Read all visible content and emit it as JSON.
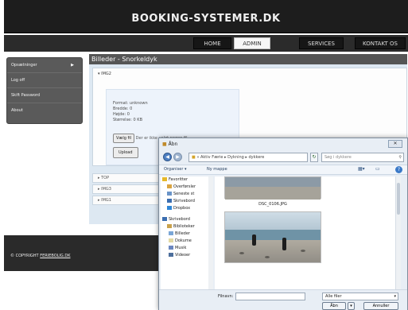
{
  "site": {
    "title": "BOOKING-SYSTEMER.DK"
  },
  "nav": {
    "items": [
      {
        "label": "HOME"
      },
      {
        "label": "ADMIN"
      },
      {
        "label": "SERVICES"
      },
      {
        "label": "KONTAKT OS"
      }
    ]
  },
  "sidebar": {
    "items": [
      {
        "label": "Opsætninger"
      },
      {
        "label": "Log off"
      },
      {
        "label": "Skift Password"
      },
      {
        "label": "About"
      }
    ]
  },
  "content": {
    "title": "Billeder - Snorkeldyk",
    "panel_header": "IMG2",
    "format": "Format: unknown",
    "width": "Bredde: 0",
    "height": "Højde: 0",
    "size": "Størrelse: 0 KB",
    "choose_label": "Vælg fil",
    "choose_status": "Der er ikke valgt nogen fil",
    "upload_label": "Upload",
    "collapsed": [
      "TOP",
      "IMG3",
      "IMG1"
    ]
  },
  "footer": {
    "prefix": "© COPYRIGHT",
    "link": "FERIEBOLIG.DK"
  },
  "dialog": {
    "title": "Åbn",
    "breadcrumb": "« Aktiv Færie ▸ Dykning ▸ dykkere",
    "search_placeholder": "Søg i dykkere",
    "organize": "Organiser ▾",
    "new_folder": "Ny mappe",
    "tree": {
      "favorites": "Favoritter",
      "fav_items": [
        "Overførsler",
        "Seneste st",
        "Skrivebord",
        "Dropbox"
      ],
      "desktop": "Skrivebord",
      "desktop_items": [
        "Biblioteker"
      ],
      "lib_items": [
        "Billeder",
        "Dokume",
        "Musik",
        "Videoer"
      ]
    },
    "files": [
      "DSC_0106.JPG"
    ],
    "filename_label": "Filnavn:",
    "filetype": "Alle filer",
    "open_label": "Åbn",
    "cancel_label": "Annuller"
  }
}
